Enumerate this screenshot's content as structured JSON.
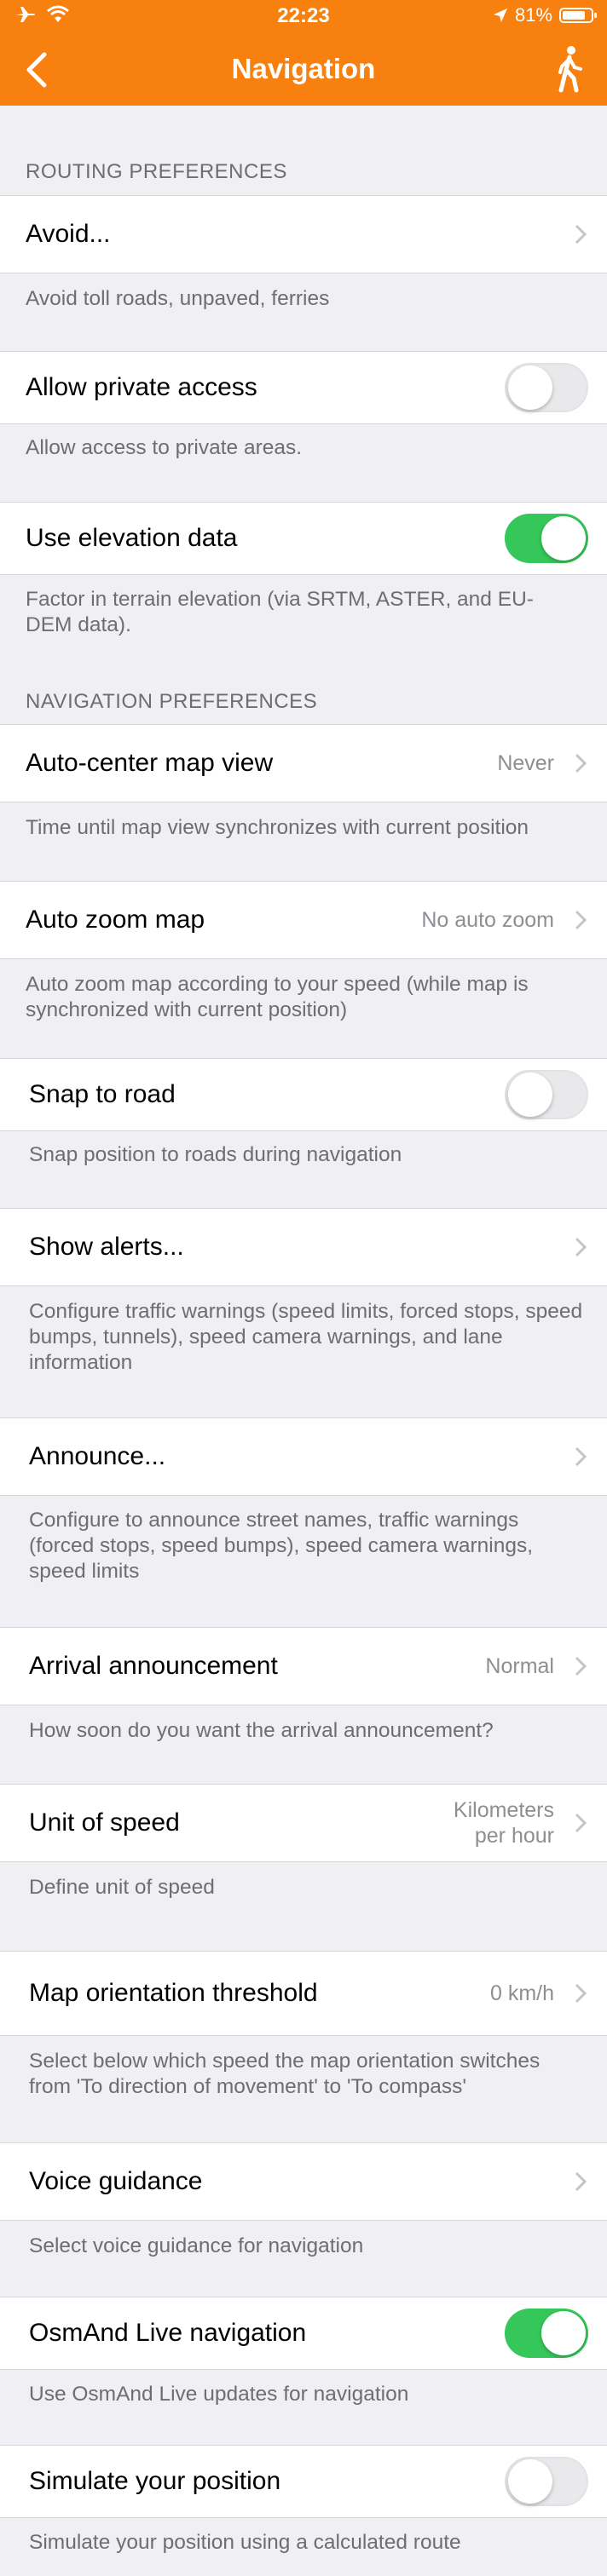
{
  "status_bar": {
    "time": "22:23",
    "battery": "81%",
    "battery_level": 0.81
  },
  "navbar": {
    "title": "Navigation"
  },
  "sections": {
    "routing": "ROUTING PREFERENCES",
    "navigation": "NAVIGATION PREFERENCES"
  },
  "rows": {
    "avoid": {
      "label": "Avoid...",
      "desc": "Avoid toll roads, unpaved, ferries"
    },
    "private_access": {
      "label": "Allow private access",
      "desc": "Allow access to private areas.",
      "on": false
    },
    "elevation": {
      "label": "Use elevation data",
      "desc": "Factor in terrain elevation (via SRTM, ASTER, and EU-DEM data).",
      "on": true
    },
    "auto_center": {
      "label": "Auto-center map view",
      "value": "Never",
      "desc": "Time until map view synchronizes with current position"
    },
    "auto_zoom": {
      "label": "Auto zoom map",
      "value": "No auto zoom",
      "desc": "Auto zoom map according to your speed (while map is synchronized with current position)"
    },
    "snap": {
      "label": "Snap to road",
      "desc": "Snap position to roads during navigation",
      "on": false
    },
    "alerts": {
      "label": "Show alerts...",
      "desc": "Configure traffic warnings (speed limits, forced stops, speed bumps, tunnels), speed camera warnings, and lane information"
    },
    "announce": {
      "label": "Announce...",
      "desc": "Configure to announce street names, traffic warnings (forced stops, speed bumps), speed camera warnings, speed limits"
    },
    "arrival": {
      "label": "Arrival announcement",
      "value": "Normal",
      "desc": "How soon do you want the arrival announcement?"
    },
    "speed_unit": {
      "label": "Unit of speed",
      "value_line1": "Kilometers",
      "value_line2": "per hour",
      "desc": "Define unit of speed"
    },
    "orientation": {
      "label": "Map orientation threshold",
      "value": "0 km/h",
      "desc": "Select below which speed the map orientation switches from 'To direction of movement' to 'To compass'"
    },
    "voice": {
      "label": "Voice guidance",
      "desc": "Select voice guidance for navigation"
    },
    "live": {
      "label": "OsmAnd Live navigation",
      "desc": "Use OsmAnd Live updates for navigation",
      "on": true
    },
    "simulate": {
      "label": "Simulate your position",
      "desc": "Simulate your position using a calculated route",
      "on": false
    }
  },
  "colors": {
    "accent": "#f7800e",
    "toggle_on": "#35c759"
  }
}
